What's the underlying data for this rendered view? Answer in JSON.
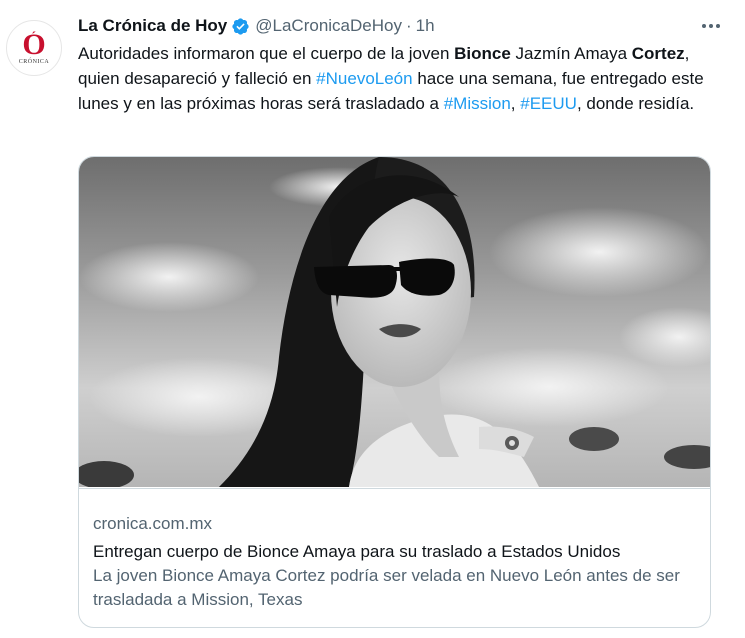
{
  "account": {
    "name": "La Crónica de Hoy",
    "handle": "@LaCronicaDeHoy",
    "separator": "·",
    "time": "1h",
    "avatar_letter": "O",
    "avatar_brand": "CRÓNICA"
  },
  "tweet": {
    "seg1": "Autoridades informaron que el cuerpo de la joven ",
    "bold1": "Bionce",
    "seg2": " Jazmín Amaya ",
    "bold2": "Cortez",
    "seg3": ", quien desapareció y falleció en ",
    "tag1": "#NuevoLeón",
    "seg4": " hace una semana, fue entregado este lunes y en las próximas horas será trasladado a ",
    "tag2": "#Mission",
    "seg5": ", ",
    "tag3": "#EEUU",
    "seg6": ", donde residía."
  },
  "card": {
    "domain": "cronica.com.mx",
    "title": "Entregan cuerpo de Bionce Amaya para su traslado a Estados Unidos",
    "description": "La joven Bionce Amaya Cortez podría ser velada en Nuevo León antes de ser trasladada a Mission, Texas"
  },
  "colors": {
    "link": "#1d9bf0",
    "muted": "#536471",
    "text": "#0f1419",
    "verified": "#1d9bf0",
    "brand_red": "#c8102e"
  },
  "icons": [
    "verified-badge-icon",
    "more-options-icon"
  ]
}
